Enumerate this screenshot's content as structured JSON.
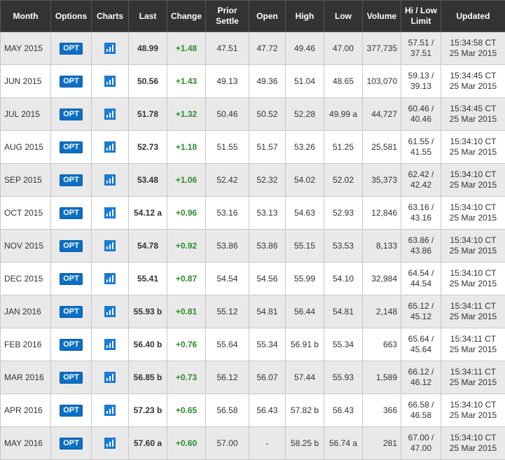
{
  "headers": {
    "month": "Month",
    "options": "Options",
    "charts": "Charts",
    "last": "Last",
    "change": "Change",
    "prior_settle_1": "Prior",
    "prior_settle_2": "Settle",
    "open": "Open",
    "high": "High",
    "low": "Low",
    "volume": "Volume",
    "limit_1": "Hi / Low",
    "limit_2": "Limit",
    "updated": "Updated"
  },
  "opt_label": "OPT",
  "chart_icon": "bar-chart-icon",
  "colors": {
    "header_bg": "#333333",
    "change_positive": "#2e8b2e",
    "opt_button": "#0b6fc5",
    "row_alt": "#e9e9e9"
  },
  "rows": [
    {
      "month": "MAY 2015",
      "last": "48.99",
      "change": "+1.48",
      "prior": "47.51",
      "open": "47.72",
      "high": "49.46",
      "low": "47.00",
      "volume": "377,735",
      "hi_limit": "57.51 /",
      "lo_limit": "37.51",
      "time": "15:34:58 CT",
      "date": "25 Mar 2015"
    },
    {
      "month": "JUN 2015",
      "last": "50.56",
      "change": "+1.43",
      "prior": "49.13",
      "open": "49.36",
      "high": "51.04",
      "low": "48.65",
      "volume": "103,070",
      "hi_limit": "59.13 /",
      "lo_limit": "39.13",
      "time": "15:34:45 CT",
      "date": "25 Mar 2015"
    },
    {
      "month": "JUL 2015",
      "last": "51.78",
      "change": "+1.32",
      "prior": "50.46",
      "open": "50.52",
      "high": "52.28",
      "low": "49.99 a",
      "volume": "44,727",
      "hi_limit": "60.46 /",
      "lo_limit": "40.46",
      "time": "15:34:45 CT",
      "date": "25 Mar 2015"
    },
    {
      "month": "AUG 2015",
      "last": "52.73",
      "change": "+1.18",
      "prior": "51.55",
      "open": "51.57",
      "high": "53.26",
      "low": "51.25",
      "volume": "25,581",
      "hi_limit": "61.55 /",
      "lo_limit": "41.55",
      "time": "15:34:10 CT",
      "date": "25 Mar 2015"
    },
    {
      "month": "SEP 2015",
      "last": "53.48",
      "change": "+1.06",
      "prior": "52.42",
      "open": "52.32",
      "high": "54.02",
      "low": "52.02",
      "volume": "35,373",
      "hi_limit": "62.42 /",
      "lo_limit": "42.42",
      "time": "15:34:10 CT",
      "date": "25 Mar 2015"
    },
    {
      "month": "OCT 2015",
      "last": "54.12 a",
      "change": "+0.96",
      "prior": "53.16",
      "open": "53.13",
      "high": "54.63",
      "low": "52.93",
      "volume": "12,846",
      "hi_limit": "63.16 /",
      "lo_limit": "43.16",
      "time": "15:34:10 CT",
      "date": "25 Mar 2015"
    },
    {
      "month": "NOV 2015",
      "last": "54.78",
      "change": "+0.92",
      "prior": "53.86",
      "open": "53.86",
      "high": "55.15",
      "low": "53.53",
      "volume": "8,133",
      "hi_limit": "63.86 /",
      "lo_limit": "43.86",
      "time": "15:34:10 CT",
      "date": "25 Mar 2015"
    },
    {
      "month": "DEC 2015",
      "last": "55.41",
      "change": "+0.87",
      "prior": "54.54",
      "open": "54.56",
      "high": "55.99",
      "low": "54.10",
      "volume": "32,984",
      "hi_limit": "64.54 /",
      "lo_limit": "44.54",
      "time": "15:34:10 CT",
      "date": "25 Mar 2015"
    },
    {
      "month": "JAN 2016",
      "last": "55.93 b",
      "change": "+0.81",
      "prior": "55.12",
      "open": "54.81",
      "high": "56.44",
      "low": "54.81",
      "volume": "2,148",
      "hi_limit": "65.12 /",
      "lo_limit": "45.12",
      "time": "15:34:11 CT",
      "date": "25 Mar 2015"
    },
    {
      "month": "FEB 2016",
      "last": "56.40 b",
      "change": "+0.76",
      "prior": "55.64",
      "open": "55.34",
      "high": "56.91 b",
      "low": "55.34",
      "volume": "663",
      "hi_limit": "65.64 /",
      "lo_limit": "45.64",
      "time": "15:34:11 CT",
      "date": "25 Mar 2015"
    },
    {
      "month": "MAR 2016",
      "last": "56.85 b",
      "change": "+0.73",
      "prior": "56.12",
      "open": "56.07",
      "high": "57.44",
      "low": "55.93",
      "volume": "1,589",
      "hi_limit": "66.12 /",
      "lo_limit": "46.12",
      "time": "15:34:11 CT",
      "date": "25 Mar 2015"
    },
    {
      "month": "APR 2016",
      "last": "57.23 b",
      "change": "+0.65",
      "prior": "56.58",
      "open": "56.43",
      "high": "57.82 b",
      "low": "56.43",
      "volume": "366",
      "hi_limit": "66.58 /",
      "lo_limit": "46.58",
      "time": "15:34:10 CT",
      "date": "25 Mar 2015"
    },
    {
      "month": "MAY 2016",
      "last": "57.60 a",
      "change": "+0.60",
      "prior": "57.00",
      "open": "-",
      "high": "58.25 b",
      "low": "56.74 a",
      "volume": "281",
      "hi_limit": "67.00 /",
      "lo_limit": "47.00",
      "time": "15:34:10 CT",
      "date": "25 Mar 2015"
    }
  ]
}
